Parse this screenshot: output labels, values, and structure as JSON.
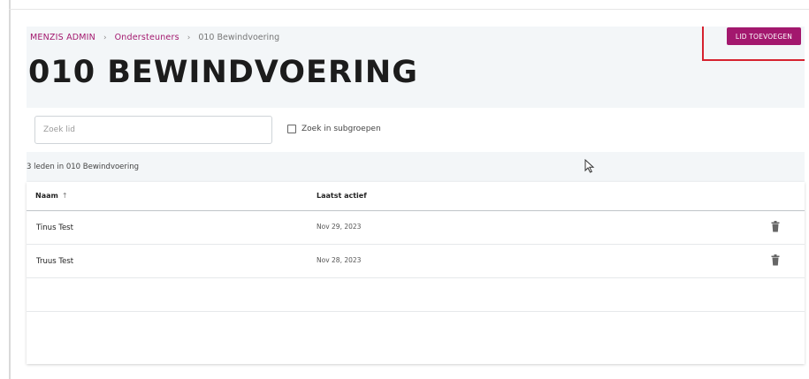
{
  "breadcrumb": {
    "root": "MENZIS ADMIN",
    "parent": "Ondersteuners",
    "current": "010 Bewindvoering",
    "separator": "›"
  },
  "header": {
    "title": "010 BEWINDVOERING",
    "add_button_label": "LID TOEVOEGEN"
  },
  "search": {
    "value": "",
    "placeholder": "Zoek lid"
  },
  "subgroups": {
    "label": "Zoek in subgroepen",
    "checked": false
  },
  "summary": {
    "count_text": "3 leden in 010 Bewindvoering"
  },
  "table": {
    "columns": [
      {
        "label": "Naam",
        "sort": "↑"
      },
      {
        "label": "Laatst actief"
      }
    ],
    "rows": [
      {
        "name": "Tinus Test",
        "last_active": "Nov 29, 2023"
      },
      {
        "name": "Truus Test",
        "last_active": "Nov 28, 2023"
      },
      {
        "name": "",
        "last_active": ""
      },
      {
        "name": "",
        "last_active": ""
      }
    ]
  },
  "colors": {
    "accent": "#a3186e",
    "annotation": "#d6222f",
    "band": "#f3f6f8"
  },
  "icons": {
    "sort": "arrow-up-icon",
    "delete": "trash-icon",
    "cursor": "mouse-pointer-icon"
  }
}
